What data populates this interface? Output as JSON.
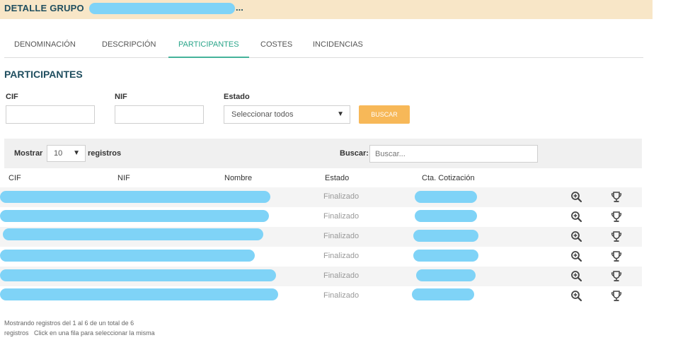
{
  "header": {
    "title": "DETALLE GRUPO",
    "ellipsis": "..."
  },
  "tabs": [
    {
      "label": "DENOMINACIÓN",
      "active": false
    },
    {
      "label": "DESCRIPCIÓN",
      "active": false
    },
    {
      "label": "PARTICIPANTES",
      "active": true
    },
    {
      "label": "COSTES",
      "active": false
    },
    {
      "label": "INCIDENCIAS",
      "active": false
    }
  ],
  "section_title": "PARTICIPANTES",
  "filters": {
    "cif_label": "CIF",
    "nif_label": "NIF",
    "estado_label": "Estado",
    "cif_value": "",
    "nif_value": "",
    "estado_selected": "Seleccionar todos",
    "search_button": "BUSCAR"
  },
  "table_controls": {
    "show_label": "Mostrar",
    "page_length": "10",
    "records_label": "registros",
    "search_label": "Buscar:",
    "search_placeholder": "Buscar..."
  },
  "table": {
    "columns": [
      "CIF",
      "NIF",
      "Nombre",
      "Estado",
      "Cta. Cotización"
    ],
    "rows": [
      {
        "estado": "Finalizado"
      },
      {
        "estado": "Finalizado"
      },
      {
        "estado": "Finalizado"
      },
      {
        "estado": "Finalizado"
      },
      {
        "estado": "Finalizado"
      },
      {
        "estado": "Finalizado"
      }
    ]
  },
  "footer": {
    "info": "Mostrando registros del 1 al 6 de un total de 6",
    "hint": "registros   Click en una fila para seleccionar la misma"
  },
  "colors": {
    "header_bg": "#f8e6c7",
    "title_color": "#1f4e5f",
    "accent_tab": "#2aa58a",
    "button_bg": "#f7b858",
    "redaction": "#7fd3f7"
  },
  "icons": {
    "view": "zoom-in-icon",
    "award": "trophy-icon"
  }
}
